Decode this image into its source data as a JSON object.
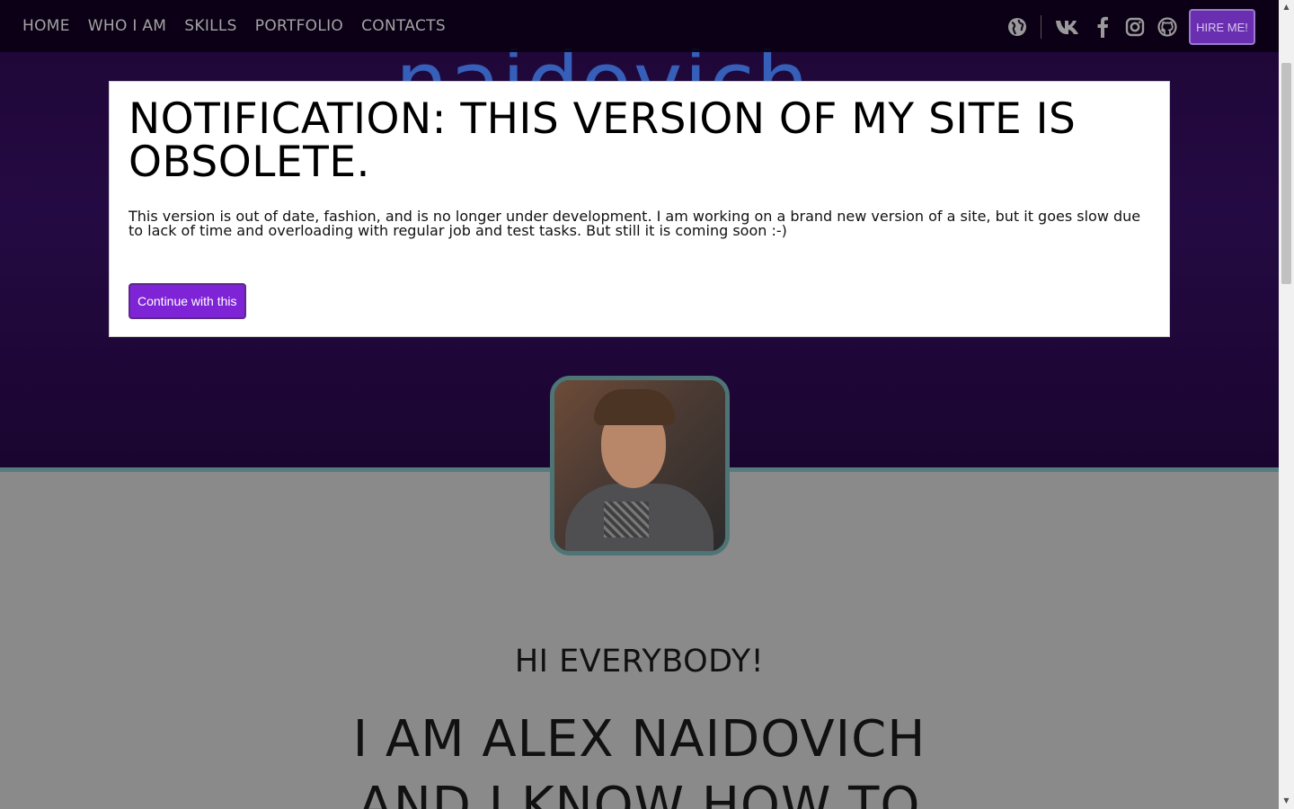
{
  "nav": {
    "items": [
      {
        "label": "HOME"
      },
      {
        "label": "WHO I AM"
      },
      {
        "label": "SKILLS"
      },
      {
        "label": "PORTFOLIO"
      },
      {
        "label": "CONTACTS"
      }
    ],
    "icons": [
      "globe-icon",
      "vk-icon",
      "facebook-icon",
      "instagram-icon",
      "github-icon"
    ],
    "hire_label": "HIRE ME!"
  },
  "hero": {
    "brand_text": "naidovich"
  },
  "modal": {
    "title": "NOTIFICATION: THIS VERSION OF MY SITE IS OBSOLETE.",
    "text": "This version is out of date, fashion, and is no longer under development. I am working on a brand new version of a site, but it goes slow due to lack of time and overloading with regular job and test tasks. But still it is coming soon :-)",
    "button_label": "Continue with this"
  },
  "about": {
    "greeting": "HI EVERYBODY!",
    "intro_line1": "I AM ALEX NAIDOVICH",
    "intro_line2": "AND I KNOW HOW TO"
  },
  "colors": {
    "accent": "#7f23d6",
    "hero_bg": "#240a42",
    "avatar_border": "#4e7476"
  }
}
